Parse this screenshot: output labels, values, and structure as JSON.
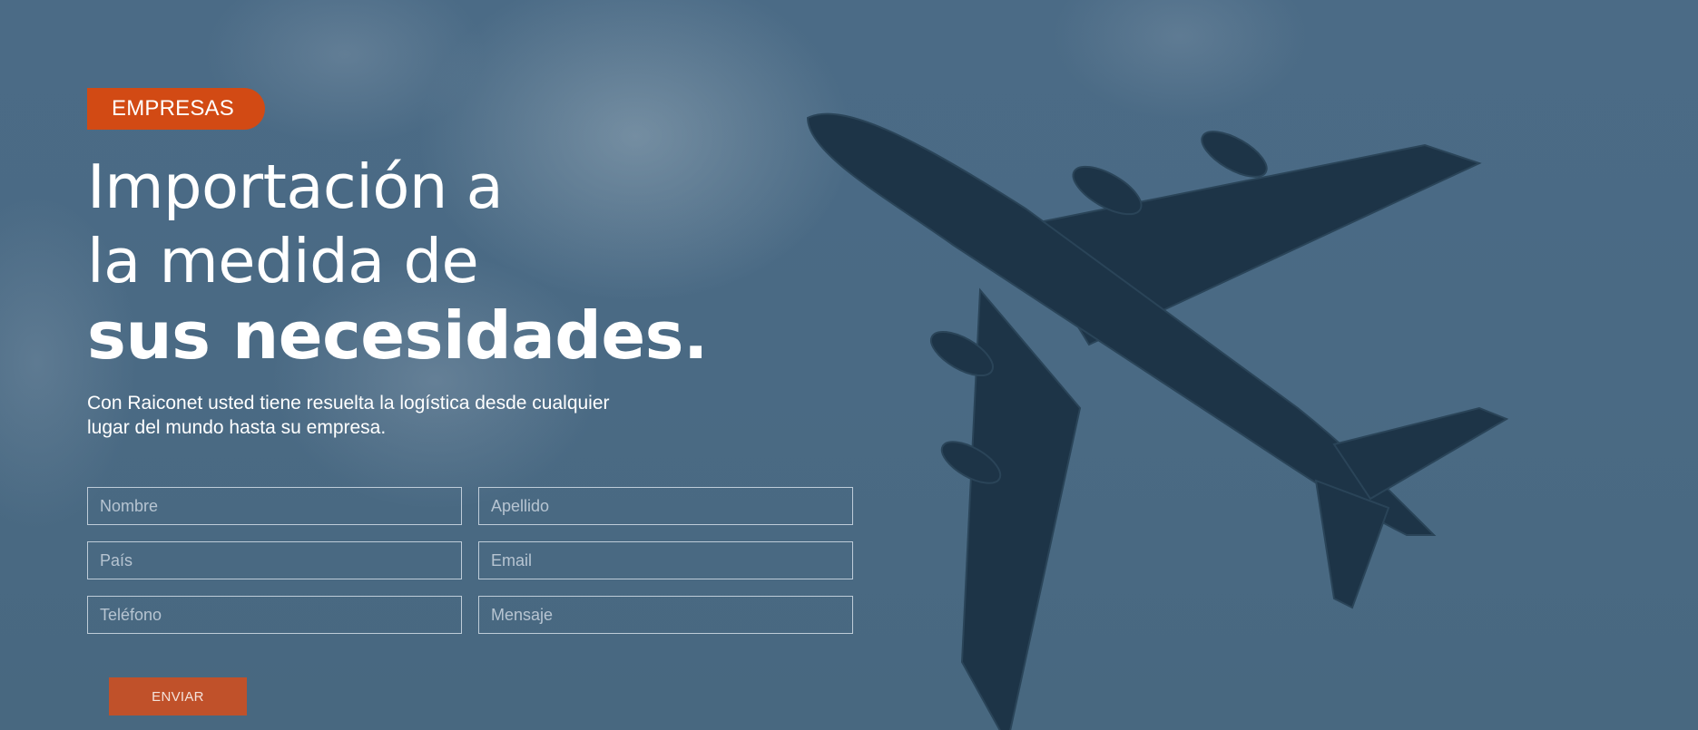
{
  "hero": {
    "badge": "EMPRESAS",
    "headline": {
      "line1": "Importación a",
      "line2": "la medida de",
      "line3": "sus necesidades."
    },
    "lead": "Con Raiconet usted tiene resuelta la logística desde cualquier lugar del mundo hasta su empresa."
  },
  "form": {
    "fields": {
      "nombre": {
        "placeholder": "Nombre"
      },
      "apellido": {
        "placeholder": "Apellido"
      },
      "pais": {
        "placeholder": "País"
      },
      "email": {
        "placeholder": "Email"
      },
      "telefono": {
        "placeholder": "Teléfono"
      },
      "mensaje": {
        "placeholder": "Mensaje"
      }
    },
    "submit_label": "ENVIAR"
  },
  "colors": {
    "accent": "#d24a14",
    "button": "#c0512a",
    "overlay": "#4a6a84"
  },
  "images": {
    "background": "airplane-sky-photo"
  }
}
